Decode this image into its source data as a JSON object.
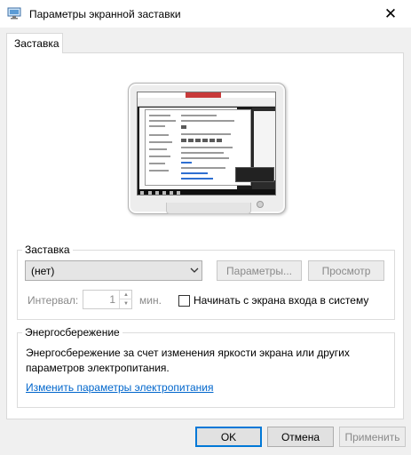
{
  "window": {
    "title": "Параметры экранной заставки",
    "close_glyph": "✕",
    "icon": "display-settings-icon"
  },
  "tabs": [
    {
      "label": "Заставка",
      "selected": true
    }
  ],
  "screensaver_group": {
    "caption": "Заставка",
    "selected_value": "(нет)",
    "parameters_button": "Параметры...",
    "preview_button": "Просмотр",
    "interval_label": "Интервал:",
    "interval_value": "1",
    "interval_unit": "мин.",
    "logon_checkbox_label": "Начинать с экрана входа в систему",
    "logon_checked": false
  },
  "energy_group": {
    "caption": "Энергосбережение",
    "description": "Энергосбережение за счет изменения яркости экрана или других параметров электропитания.",
    "link": "Изменить параметры электропитания"
  },
  "footer": {
    "ok": "OK",
    "cancel": "Отмена",
    "apply": "Применить"
  },
  "colors": {
    "accent": "#0078d7",
    "link": "#0066cc",
    "disabled_text": "#8a8a8a"
  }
}
